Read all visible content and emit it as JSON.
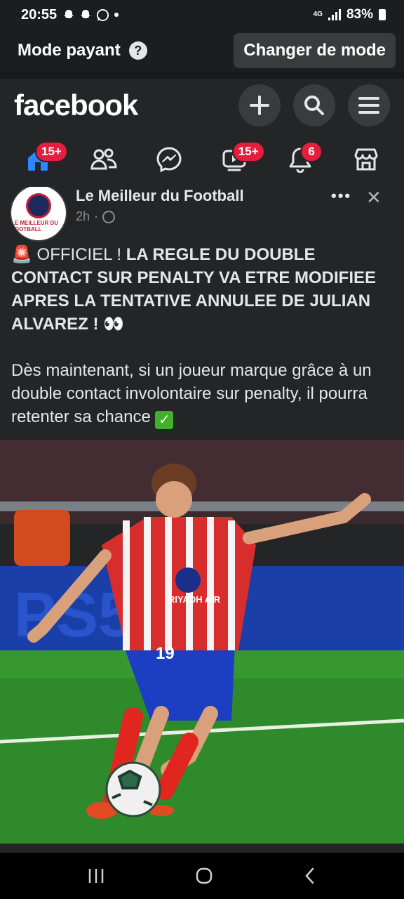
{
  "status_bar": {
    "time": "20:55",
    "network": "4G",
    "battery": "83%"
  },
  "mode_bar": {
    "label": "Mode payant",
    "help_glyph": "?",
    "change_button": "Changer de mode"
  },
  "header": {
    "logo": "facebook",
    "actions": [
      "plus-icon",
      "search-icon",
      "menu-icon"
    ]
  },
  "tabs": [
    {
      "name": "home",
      "badge": "15+",
      "active": true
    },
    {
      "name": "friends",
      "badge": ""
    },
    {
      "name": "messenger",
      "badge": ""
    },
    {
      "name": "video",
      "badge": "15+"
    },
    {
      "name": "notifications",
      "badge": "6"
    },
    {
      "name": "marketplace",
      "badge": ""
    }
  ],
  "post": {
    "page_name": "Le Meilleur du Football",
    "time": "2h",
    "dot": "·",
    "more": "•••",
    "close": "✕",
    "avatar_text": "LE MEILLEUR DU FOOTBALL",
    "text_intro": "🚨 OFFICIEL ! ",
    "text_bold": "LA REGLE DU DOUBLE CONTACT SUR PENALTY VA ETRE MODIFIEE APRES LA TENTATIVE ANNULEE DE JULIAN ALVAREZ !",
    "text_eyes": " 👀",
    "text_body": "Dès maintenant, si un joueur marque grâce à un double contact involontaire sur penalty, il pourra retenter sa chance ",
    "check": "✓",
    "image": {
      "jersey_sponsor": "RIYADH AIR",
      "jersey_number": "19"
    }
  },
  "colors": {
    "background": "#242526",
    "accent": "#2d88ff",
    "badge": "#e41e3f"
  }
}
